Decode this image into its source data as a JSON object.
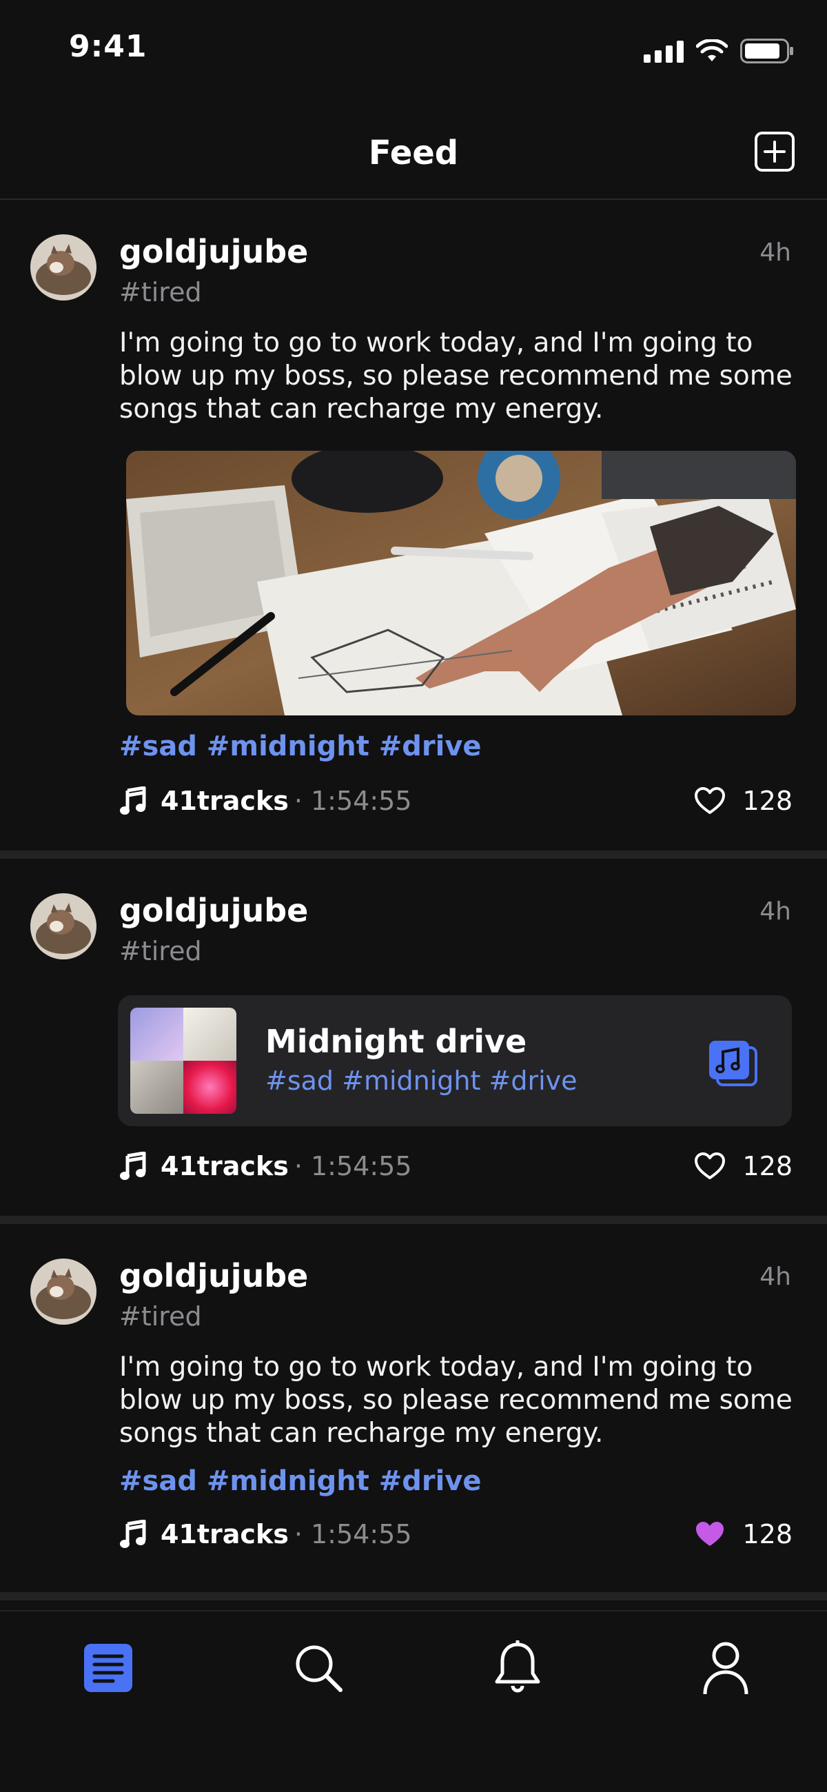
{
  "status": {
    "time": "9:41"
  },
  "header": {
    "title": "Feed"
  },
  "posts": [
    {
      "username": "goldjujube",
      "mood": "#tired",
      "time": "4h",
      "text": "I'm going to go to work today, and I'm going to blow up my boss, so please recommend me some songs that can recharge my energy.",
      "tags": "#sad #midnight #drive",
      "tracks": "41tracks",
      "duration": "· 1:54:55",
      "likes": "128",
      "liked": false
    },
    {
      "username": "goldjujube",
      "mood": "#tired",
      "time": "4h",
      "playlist": {
        "title": "Midnight drive",
        "tags": "#sad #midnight #drive"
      },
      "tracks": "41tracks",
      "duration": "· 1:54:55",
      "likes": "128",
      "liked": false
    },
    {
      "username": "goldjujube",
      "mood": "#tired",
      "time": "4h",
      "text": "I'm going to go to work today, and I'm going to blow up my boss, so please recommend me some songs that can recharge my energy.",
      "tags": "#sad #midnight #drive",
      "tracks": "41tracks",
      "duration": "· 1:54:55",
      "likes": "128",
      "liked": true
    }
  ],
  "tabs": [
    {
      "name": "feed",
      "active": true
    },
    {
      "name": "search",
      "active": false
    },
    {
      "name": "notifications",
      "active": false
    },
    {
      "name": "profile",
      "active": false
    }
  ],
  "colors": {
    "accent": "#4a72f5",
    "tag": "#6e93ef",
    "like_active": "#c45ae6",
    "background": "#111112"
  },
  "icons": [
    "signal-icon",
    "wifi-icon",
    "battery-icon",
    "add-post-icon",
    "music-note-icon",
    "heart-icon",
    "playlist-icon",
    "feed-icon",
    "search-icon",
    "bell-icon",
    "profile-icon"
  ]
}
